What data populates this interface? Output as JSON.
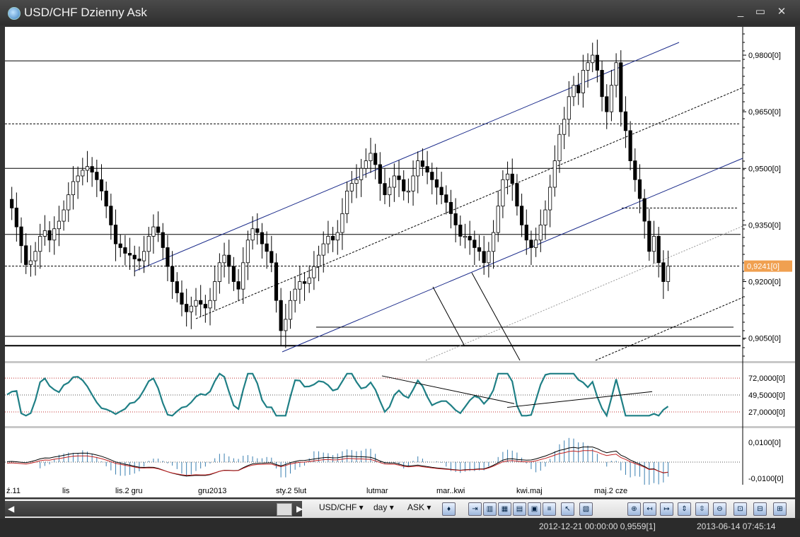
{
  "window": {
    "title": "USD/CHF Dzienny Ask",
    "controls": {
      "minimize": "_",
      "maximize": "▭",
      "close": "✕"
    }
  },
  "price_axis": {
    "labels": [
      "0,9800[0]",
      "0,9650[0]",
      "0,9500[0]",
      "0,9350[0]",
      "0,9200[0]",
      "0,9050[0]"
    ],
    "current": "0,9241[0]",
    "current_color": "#f0a050"
  },
  "rsi_axis": {
    "labels": [
      "72,0000[0]",
      "49,5000[0]",
      "27,0000[0]"
    ]
  },
  "macd_axis": {
    "labels": [
      "0,0100[0]",
      "-0,0100[0]"
    ]
  },
  "time_axis": {
    "labels": [
      "ź.11",
      "lis",
      "lis.2 gru",
      "gru2013",
      "sty.2 5lut",
      "lutmar",
      "mar..kwi",
      "kwi.maj",
      "maj.2 cze"
    ]
  },
  "toolbar": {
    "instrument": "USD/CHF",
    "period": "day",
    "side": "ASK",
    "icons": [
      "candle-type-icon",
      "chart-icon-1",
      "chart-icon-2",
      "chart-icon-3",
      "chart-icon-4",
      "chart-icon-5",
      "chart-icon-6",
      "cursor-icon",
      "template-icon",
      "zoom-in-icon",
      "shift-left-icon",
      "shift-right-icon",
      "expand-icon",
      "compress-icon",
      "zoom-out-icon",
      "indicator-icon-1",
      "indicator-icon-2",
      "indicator-icon-3"
    ]
  },
  "status": {
    "cursor_info": "2012-12-21 00:00:00  0,9559[1]",
    "server_time": "2013-06-14 07:45:14"
  },
  "chart_data": {
    "type": "line",
    "title": "",
    "price_range": [
      0.8995,
      0.9875
    ],
    "close_series": [
      0.9418,
      0.9395,
      0.9345,
      0.9295,
      0.9245,
      0.9255,
      0.928,
      0.932,
      0.9335,
      0.931,
      0.934,
      0.936,
      0.939,
      0.943,
      0.9465,
      0.948,
      0.9495,
      0.9505,
      0.949,
      0.947,
      0.944,
      0.94,
      0.935,
      0.93,
      0.929,
      0.9275,
      0.927,
      0.926,
      0.9255,
      0.928,
      0.932,
      0.9345,
      0.933,
      0.929,
      0.924,
      0.92,
      0.917,
      0.914,
      0.912,
      0.9135,
      0.915,
      0.914,
      0.913,
      0.915,
      0.92,
      0.925,
      0.927,
      0.924,
      0.92,
      0.918,
      0.925,
      0.931,
      0.934,
      0.933,
      0.93,
      0.928,
      0.925,
      0.915,
      0.907,
      0.91,
      0.915,
      0.918,
      0.92,
      0.9195,
      0.921,
      0.924,
      0.927,
      0.93,
      0.932,
      0.931,
      0.933,
      0.938,
      0.944,
      0.946,
      0.947,
      0.95,
      0.952,
      0.954,
      0.951,
      0.946,
      0.943,
      0.945,
      0.948,
      0.947,
      0.944,
      0.944,
      0.948,
      0.952,
      0.9505,
      0.949,
      0.947,
      0.945,
      0.943,
      0.941,
      0.938,
      0.935,
      0.932,
      0.932,
      0.931,
      0.929,
      0.928,
      0.925,
      0.928,
      0.933,
      0.94,
      0.947,
      0.9485,
      0.946,
      0.94,
      0.935,
      0.931,
      0.929,
      0.931,
      0.935,
      0.939,
      0.945,
      0.952,
      0.959,
      0.963,
      0.969,
      0.972,
      0.97,
      0.976,
      0.978,
      0.98,
      0.976,
      0.969,
      0.965,
      0.972,
      0.978,
      0.965,
      0.96,
      0.952,
      0.947,
      0.942,
      0.936,
      0.928,
      0.932,
      0.925,
      0.92,
      0.9241
    ],
    "horizontal_levels": [
      0.9785,
      0.9618,
      0.95,
      0.9325,
      0.9241,
      0.9055,
      0.903
    ],
    "rsi_levels": [
      72.0,
      49.5,
      27.0
    ],
    "macd_range": [
      -0.01,
      0.01
    ]
  }
}
